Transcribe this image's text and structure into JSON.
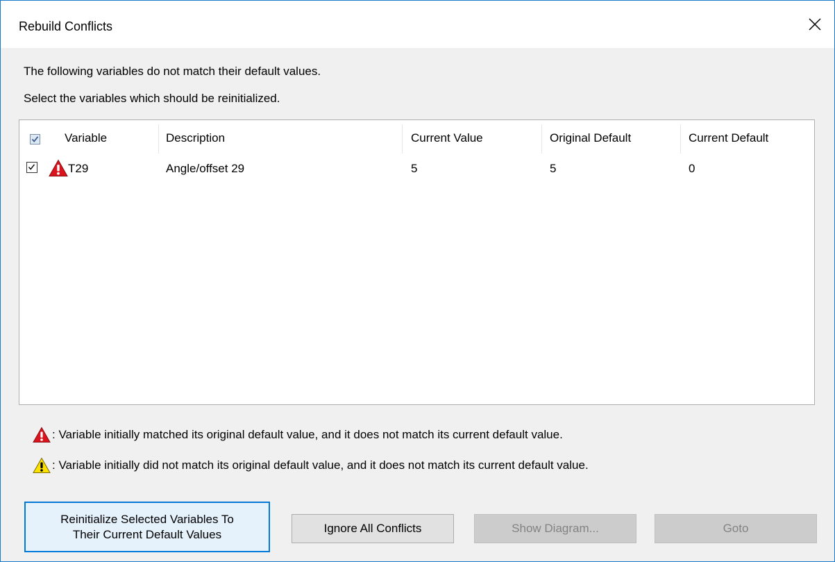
{
  "window": {
    "title": "Rebuild Conflicts"
  },
  "intro": {
    "line1": "The following variables do not match their default values.",
    "line2": "Select the variables which should be reinitialized."
  },
  "table": {
    "header_checked": true,
    "columns": [
      "Variable",
      "Description",
      "Current Value",
      "Original Default",
      "Current Default"
    ],
    "rows": [
      {
        "checked": true,
        "icon": "warning-red-icon",
        "variable": "T29",
        "description": "Angle/offset 29",
        "current_value": "5",
        "original_default": "5",
        "current_default": "0"
      }
    ]
  },
  "legend": {
    "red": ": Variable initially matched its original default value, and it does not match its current default value.",
    "yellow": ": Variable initially did not match its original default value, and it does not match its current default value.",
    "red_color": "#d9141d",
    "yellow_color": "#fce100"
  },
  "buttons": {
    "reinitialize_line1": "Reinitialize Selected Variables To",
    "reinitialize_line2": "Their Current Default Values",
    "ignore": "Ignore All Conflicts",
    "show_diagram": "Show Diagram...",
    "goto": "Goto"
  }
}
